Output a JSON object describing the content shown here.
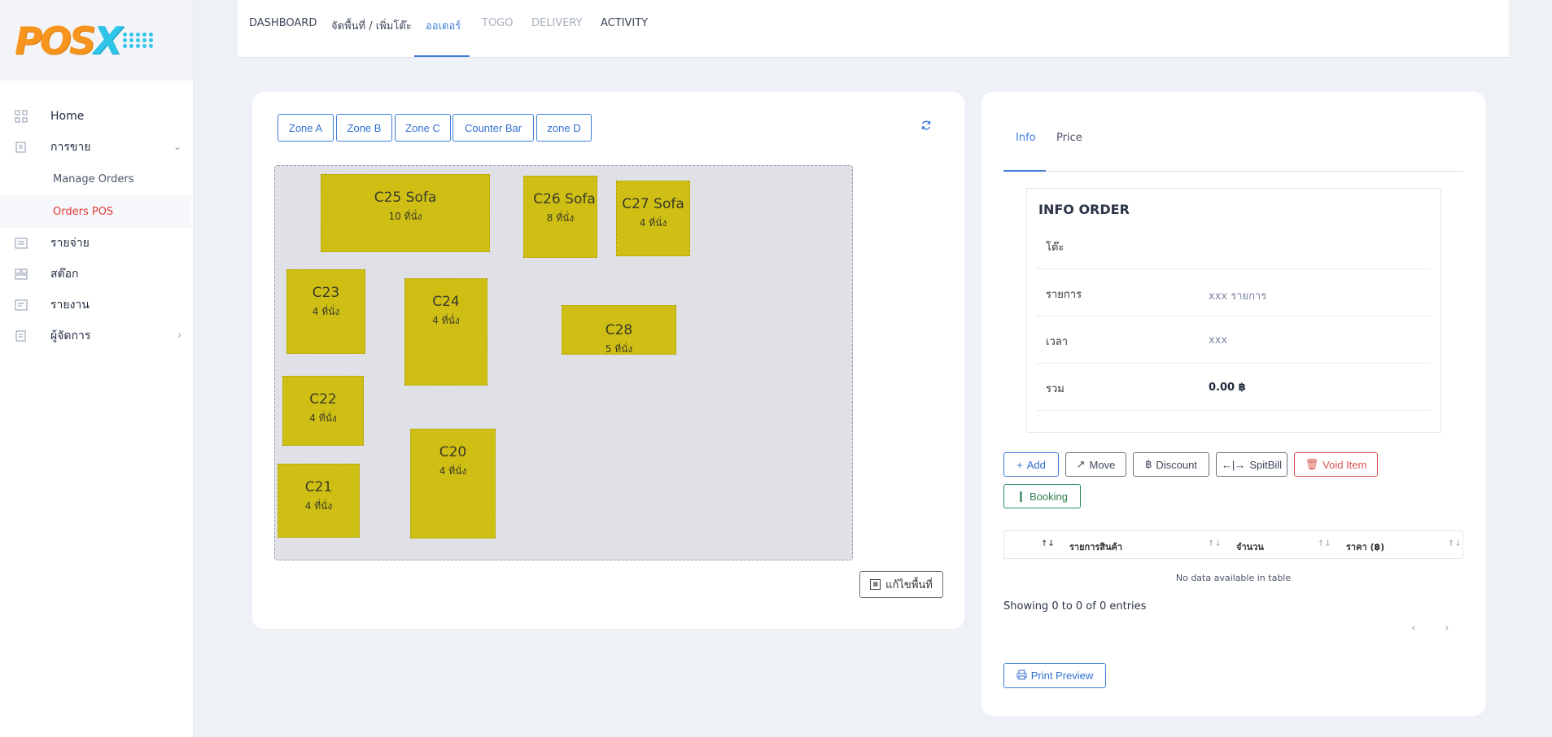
{
  "brand": {
    "logo_main": "POS",
    "logo_x": "X"
  },
  "sidebar": {
    "items": [
      {
        "label": "Home",
        "icon": "grid-icon"
      },
      {
        "label": "การขาย",
        "icon": "receipt-icon"
      },
      {
        "label": "Manage Orders"
      },
      {
        "label": "Orders POS"
      },
      {
        "label": "รายจ่าย",
        "icon": "list-icon"
      },
      {
        "label": "สต๊อก",
        "icon": "stock-icon"
      },
      {
        "label": "รายงาน",
        "icon": "report-icon"
      },
      {
        "label": "ผู้จัดการ",
        "icon": "manager-icon"
      }
    ]
  },
  "topbar": {
    "tabs": [
      {
        "label": "DASHBOARD"
      },
      {
        "label": "จัดพื้นที่ / เพิ่มโต๊ะ"
      },
      {
        "label": "ออเดอร์"
      },
      {
        "label": "TOGO"
      },
      {
        "label": "DELIVERY"
      },
      {
        "label": "ACTIVITY"
      }
    ],
    "active_tab": "ออเดอร์"
  },
  "zones": [
    "Zone A",
    "Zone B",
    "Zone C",
    "Counter Bar",
    "zone D"
  ],
  "tables": [
    {
      "name": "C25 Sofa",
      "seats": "10 ที่นั่ง"
    },
    {
      "name": "C26 Sofa",
      "seats": "8 ที่นั่ง"
    },
    {
      "name": "C27 Sofa",
      "seats": "4 ที่นั่ง"
    },
    {
      "name": "C23",
      "seats": "4 ที่นั่ง"
    },
    {
      "name": "C24",
      "seats": "4 ที่นั่ง"
    },
    {
      "name": "C28",
      "seats": "5 ที่นั่ง"
    },
    {
      "name": "C22",
      "seats": "4 ที่นั่ง"
    },
    {
      "name": "C20",
      "seats": "4 ที่นั่ง"
    },
    {
      "name": "C21",
      "seats": "4 ที่นั่ง"
    }
  ],
  "edit_floor_label": "แก้ไขพื้นที่",
  "right_tabs": {
    "info": "Info",
    "price": "Price"
  },
  "info_order": {
    "title": "INFO ORDER",
    "rows": [
      {
        "label": "โต๊ะ",
        "value": ""
      },
      {
        "label": "รายการ",
        "value": "xxx รายการ"
      },
      {
        "label": "เวลา",
        "value": "xxx"
      },
      {
        "label": "รวม",
        "value": "0.00 ฿"
      }
    ]
  },
  "actions": {
    "add": "Add",
    "move": "Move",
    "discount": "Discount",
    "split": "SpitBill",
    "void": "Void Item",
    "booking": "Booking"
  },
  "order_table": {
    "columns": [
      "รายการสินค้า",
      "จำนวน",
      "ราคา (฿)"
    ],
    "empty": "No data available in table",
    "info": "Showing 0 to 0 of 0 entries"
  },
  "print_label": "Print Preview",
  "colors": {
    "accent": "#3f7dd9",
    "table_fill": "#cfbf14",
    "danger": "#d9534f",
    "success": "#2e8b57",
    "active_sub": "#e53935"
  }
}
